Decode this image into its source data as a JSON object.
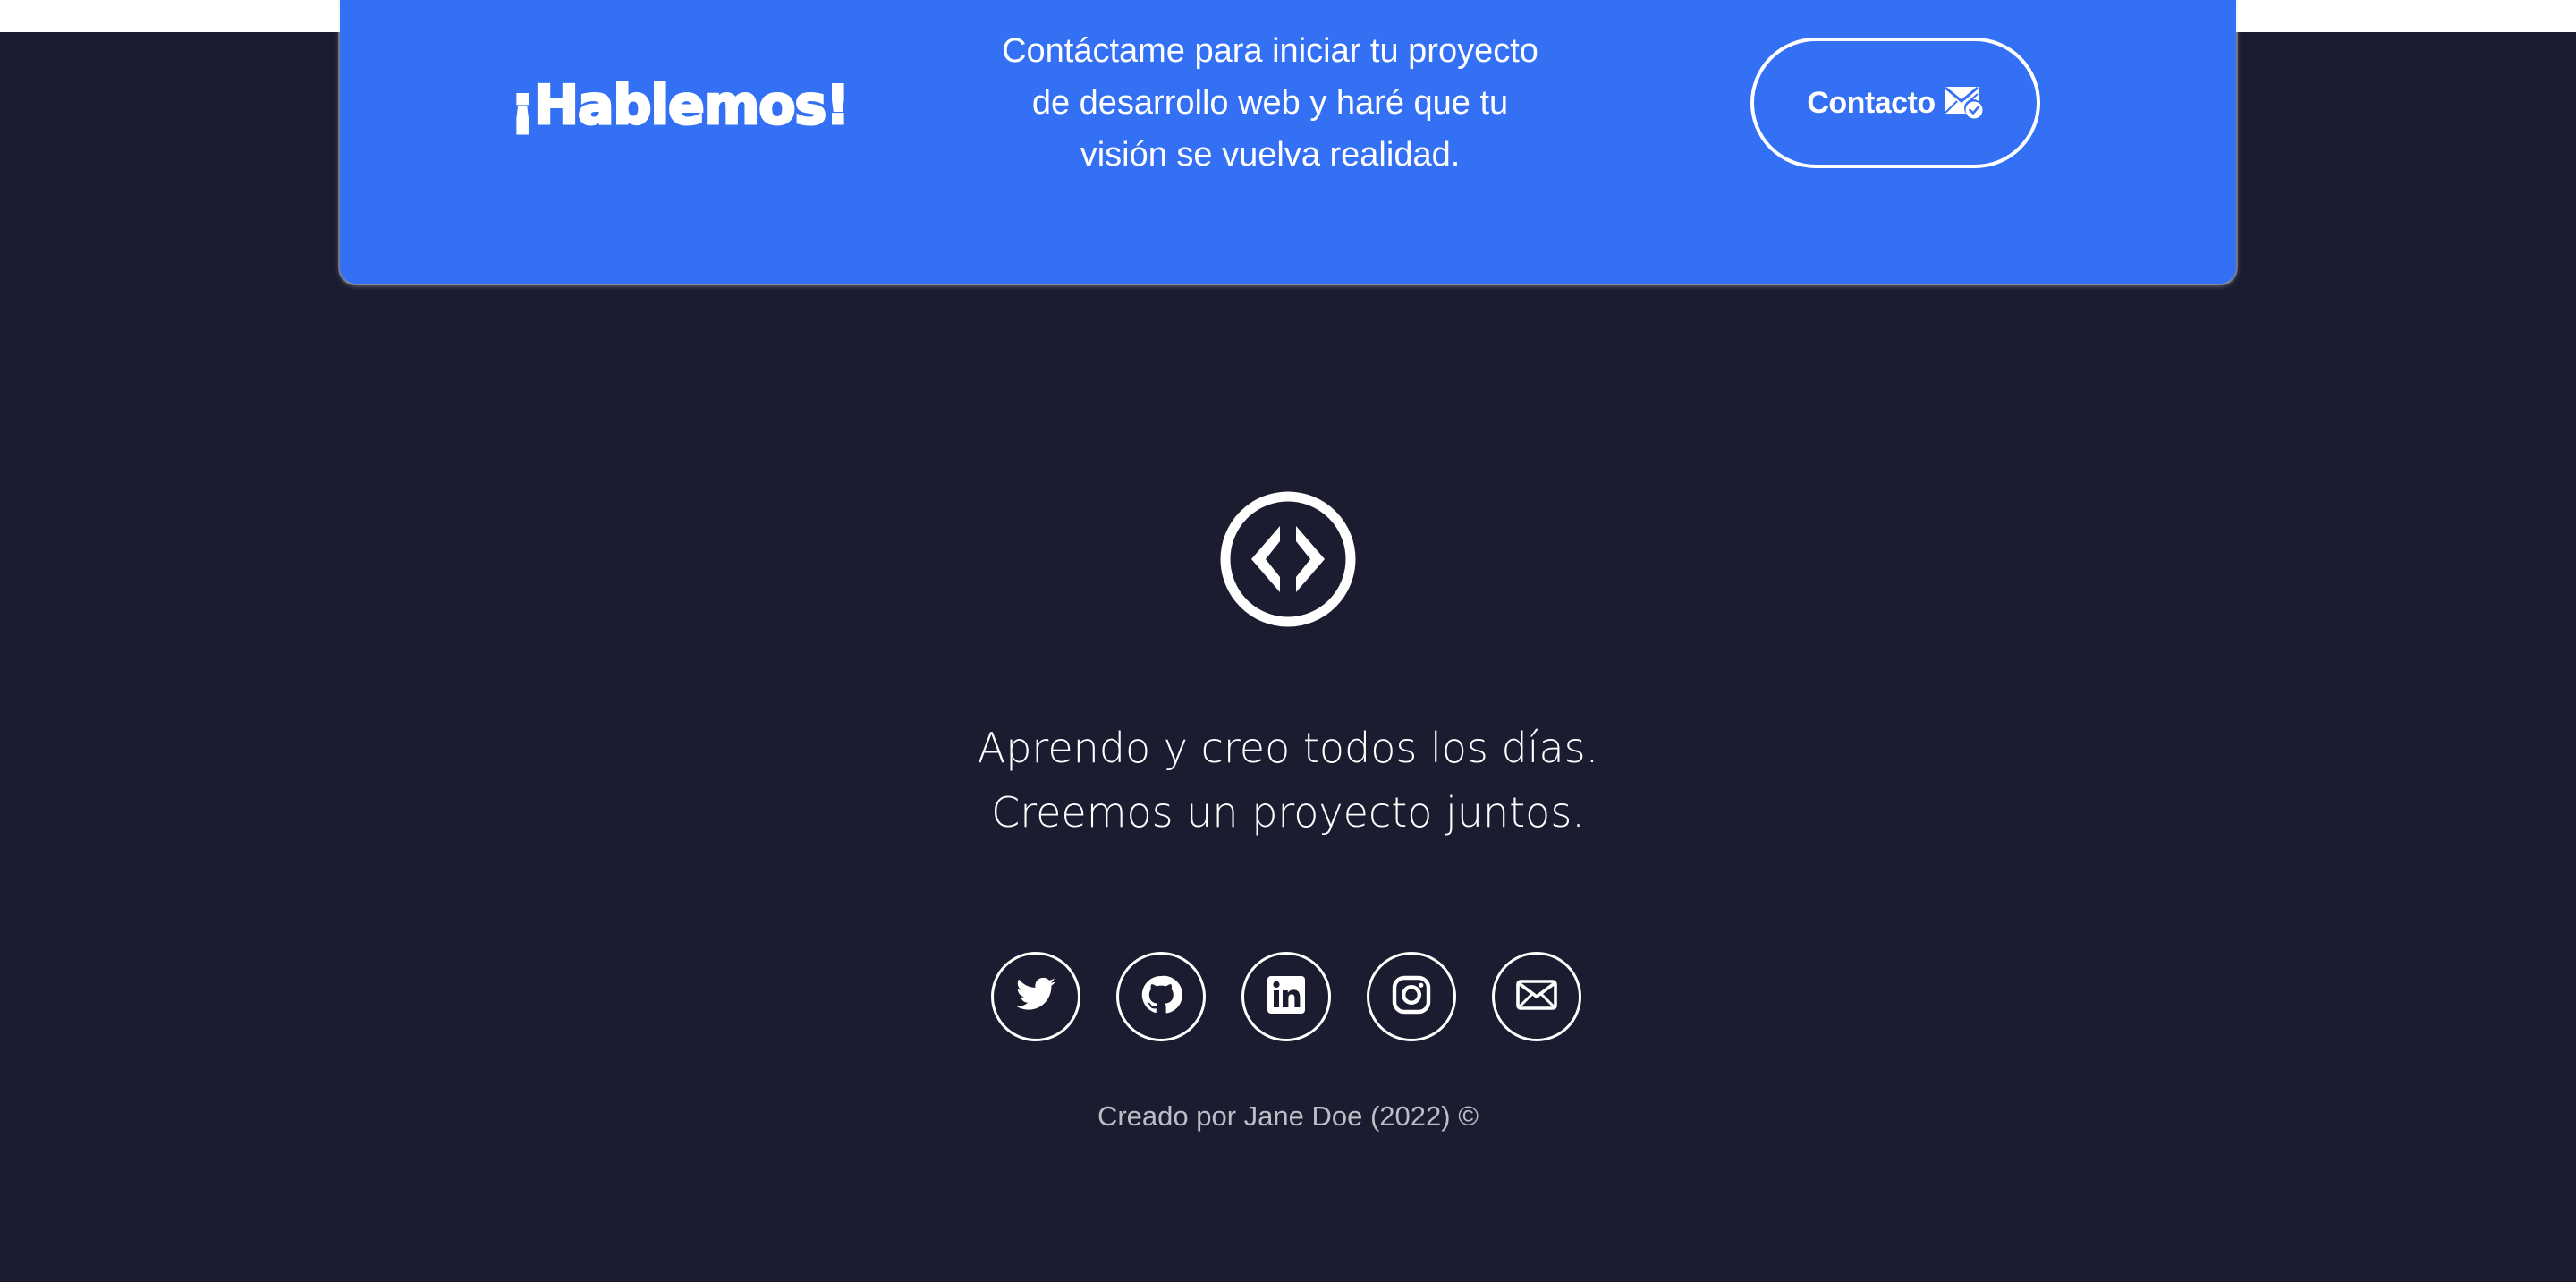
{
  "colors": {
    "page_background": "#ffffff",
    "footer_background": "#1c1c30",
    "cta_background": "#3470f3",
    "text_primary": "#ffffff",
    "text_muted": "#bdbdc6"
  },
  "cta": {
    "title": "¡Hablemos!",
    "text": "Contáctame para iniciar tu proyecto de desarrollo web y haré que tu visión se vuelva realidad.",
    "button_label": "Contacto",
    "button_icon": "mail-check-icon"
  },
  "footer": {
    "logo_icon": "code-logo-icon",
    "tagline": [
      "Aprendo y creo todos los días.",
      "Creemos un proyecto juntos."
    ],
    "socials": [
      {
        "name": "Twitter",
        "icon": "twitter-icon"
      },
      {
        "name": "GitHub",
        "icon": "github-icon"
      },
      {
        "name": "LinkedIn",
        "icon": "linkedin-icon"
      },
      {
        "name": "Instagram",
        "icon": "instagram-icon"
      },
      {
        "name": "Email",
        "icon": "email-icon"
      }
    ],
    "copyright": "Creado por Jane Doe (2022) ©"
  }
}
